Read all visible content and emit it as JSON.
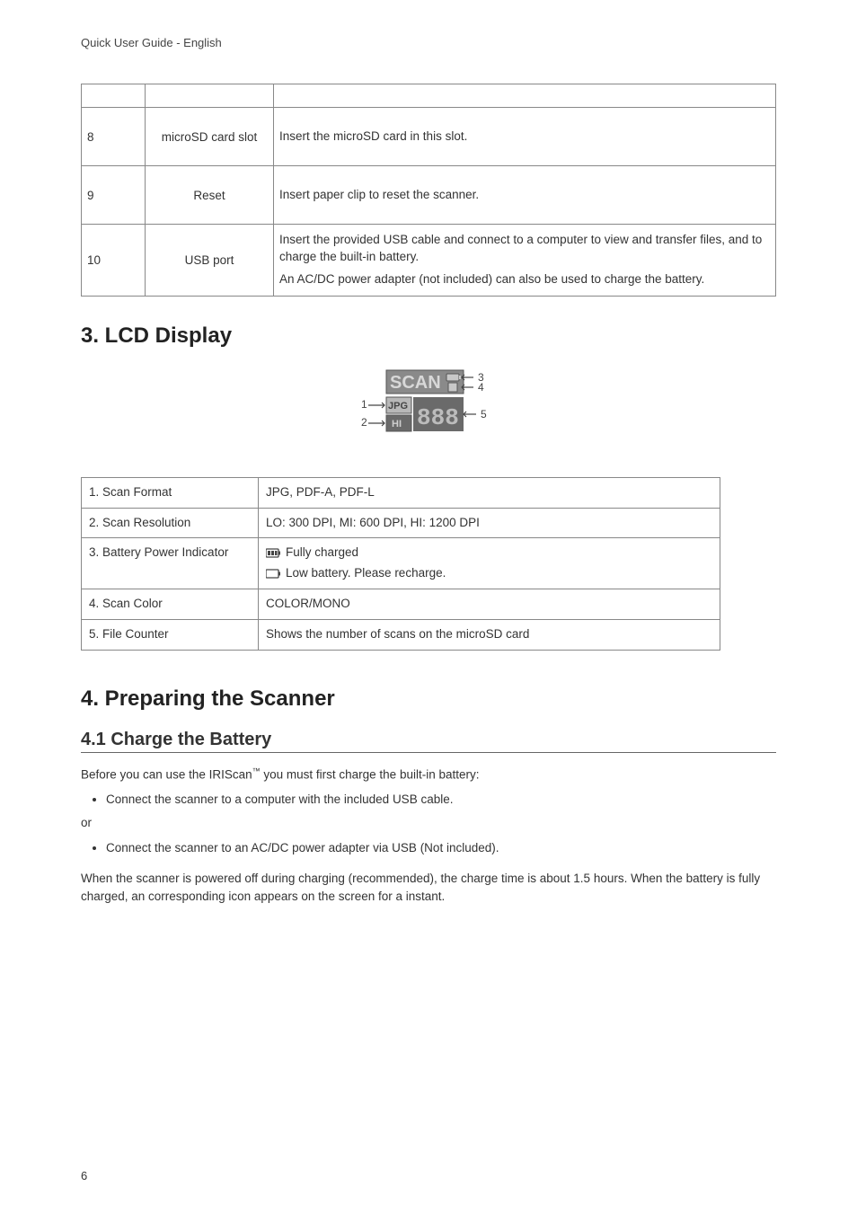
{
  "header": "Quick User Guide - English",
  "page_number": "6",
  "hardware_table": {
    "rows": [
      {
        "num": "8",
        "name": "microSD card slot",
        "desc": [
          "Insert the microSD card in this slot."
        ]
      },
      {
        "num": "9",
        "name": "Reset",
        "desc": [
          "Insert paper clip to reset the scanner."
        ]
      },
      {
        "num": "10",
        "name": "USB port",
        "desc": [
          "Insert the provided USB cable and connect to a computer to view and transfer files, and to charge the built-in battery.",
          "An AC/DC power adapter (not included) can also be used to charge the battery."
        ]
      }
    ]
  },
  "section_lcd": "3. LCD Display",
  "lcd_table": {
    "rows": [
      {
        "label": "1. Scan Format",
        "value": "JPG, PDF-A, PDF-L"
      },
      {
        "label": "2. Scan Resolution",
        "value": "LO: 300 DPI, MI: 600 DPI, HI: 1200 DPI"
      },
      {
        "label": "3. Battery Power Indicator",
        "value_a": "Fully charged",
        "value_b": "Low battery. Please recharge."
      },
      {
        "label": "4. Scan Color",
        "value": "COLOR/MONO"
      },
      {
        "label": "5. File Counter",
        "value": "Shows the number of scans on the microSD card"
      }
    ]
  },
  "section_prep": "4. Preparing the Scanner",
  "subsection_charge": "4.1 Charge the Battery",
  "charge_intro_a": "Before you can use the IRIScan",
  "charge_intro_b": " you must first charge the built-in battery:",
  "bullet_usb": "Connect the scanner to a computer with the included USB cable.",
  "or": "or",
  "bullet_ac": "Connect the scanner to an AC/DC power adapter via USB (Not included).",
  "charge_note": "When the scanner is powered off during charging (recommended), the charge time is about 1.5 hours. When the battery is fully charged, an corresponding icon appears on the screen for a instant."
}
